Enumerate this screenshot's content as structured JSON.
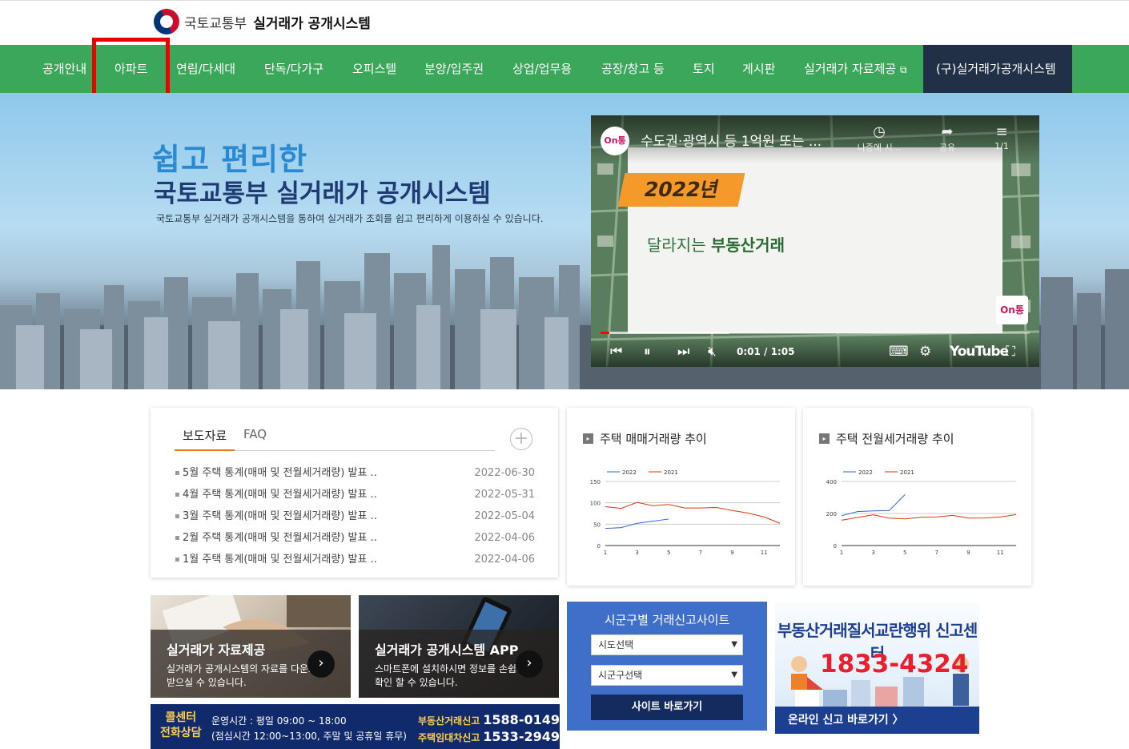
{
  "header": {
    "org": "국토교통부",
    "title": "실거래가 공개시스템"
  },
  "nav": {
    "items": [
      {
        "label": "공개안내"
      },
      {
        "label": "아파트"
      },
      {
        "label": "연립/다세대"
      },
      {
        "label": "단독/다가구"
      },
      {
        "label": "오피스텔"
      },
      {
        "label": "분양/입주권"
      },
      {
        "label": "상업/업무용"
      },
      {
        "label": "공장/창고 등"
      },
      {
        "label": "토지"
      },
      {
        "label": "게시판"
      },
      {
        "label": "실거래가 자료제공"
      },
      {
        "label": "(구)실거래가공개시스템"
      }
    ]
  },
  "hero": {
    "title1": "쉽고 편리한",
    "title2": "국토교통부 실거래가 공개시스템",
    "desc": "국토교통부 실거래가 공개시스템을 통하여 실거래가 조회를 쉽고 편리하게 이용하실 수 있습니다."
  },
  "video": {
    "channel": "On통",
    "title": "수도권·광역시 등 1억원 또는 ...",
    "watch_later": "나중에 시...",
    "share": "공유",
    "playlist": "1/1",
    "year": "2022년",
    "headline_pre": "달라지는 ",
    "headline_bold": "부동산거래",
    "time": "0:01 / 1:05",
    "youtube": "YouTube",
    "progress": 0.02,
    "buffered": 0.3
  },
  "news": {
    "tabs": [
      "보도자료",
      "FAQ"
    ],
    "items": [
      {
        "title": "5월 주택 통계(매매 및 전월세거래량) 발표 ..",
        "date": "2022-06-30"
      },
      {
        "title": "4월 주택 통계(매매 및 전월세거래량) 발표 ..",
        "date": "2022-05-31"
      },
      {
        "title": "3월 주택 통계(매매 및 전월세거래량) 발표 ..",
        "date": "2022-05-04"
      },
      {
        "title": "2월 주택 통계(매매 및 전월세거래량) 발표 ..",
        "date": "2022-04-06"
      },
      {
        "title": "1월 주택 통계(매매 및 전월세거래량) 발표 ..",
        "date": "2022-04-06"
      }
    ]
  },
  "chart_data": [
    {
      "type": "line",
      "title": "주택 매매거래량 추이",
      "x": [
        1,
        2,
        3,
        4,
        5,
        6,
        7,
        8,
        9,
        10,
        11,
        12
      ],
      "xticks": [
        1,
        3,
        5,
        7,
        9,
        11
      ],
      "ylim": [
        0,
        150
      ],
      "yticks": [
        0,
        50,
        100,
        150
      ],
      "series": [
        {
          "name": "2022",
          "color": "#3366cc",
          "values": [
            40,
            42,
            52,
            57,
            62,
            null,
            null,
            null,
            null,
            null,
            null,
            null
          ]
        },
        {
          "name": "2021",
          "color": "#dc3912",
          "values": [
            91,
            87,
            101,
            93,
            96,
            88,
            88,
            89,
            82,
            76,
            67,
            52
          ]
        }
      ],
      "grid": true,
      "legend": "top-left"
    },
    {
      "type": "line",
      "title": "주택 전월세거래량 추이",
      "x": [
        1,
        2,
        3,
        4,
        5,
        6,
        7,
        8,
        9,
        10,
        11,
        12
      ],
      "xticks": [
        1,
        3,
        5,
        7,
        9,
        11
      ],
      "ylim": [
        0,
        400
      ],
      "yticks": [
        0,
        200,
        400
      ],
      "series": [
        {
          "name": "2022",
          "color": "#3366cc",
          "values": [
            186,
            212,
            216,
            218,
            318,
            null,
            null,
            null,
            null,
            null,
            null,
            null
          ]
        },
        {
          "name": "2021",
          "color": "#dc3912",
          "values": [
            158,
            175,
            192,
            171,
            166,
            176,
            178,
            188,
            171,
            172,
            178,
            193
          ]
        }
      ],
      "grid": true,
      "legend": "top-left"
    }
  ],
  "banners": {
    "data": {
      "title": "실거래가 자료제공",
      "desc": "실거래가 공개시스템의 자료를 다운로드 받으실 수 있습니다."
    },
    "app": {
      "title": "실거래가 공개시스템 APP",
      "desc": "스마트폰에 설치하시면 정보를 손쉽게 확인 할 수 있습니다."
    }
  },
  "callcenter": {
    "head1": "콜센터",
    "head2": "전화상담",
    "hours1": "운영시간 : 평일 09:00 ~ 18:00",
    "hours2": "(점심시간 12:00~13:00, 주말 및 공휴일 휴무)",
    "label1": "부동산거래신고",
    "phone1": "1588-0149",
    "label2": "주택임대차신고",
    "phone2": "1533-2949"
  },
  "sigun": {
    "title": "시군구별 거래신고사이트",
    "sido": "시도선택",
    "sigungu": "시군구선택",
    "go": "사이트 바로가기"
  },
  "report": {
    "title": "부동산거래질서교란행위 신고센터",
    "phone": "1833-4324",
    "link": "온라인 신고 바로가기 〉"
  }
}
